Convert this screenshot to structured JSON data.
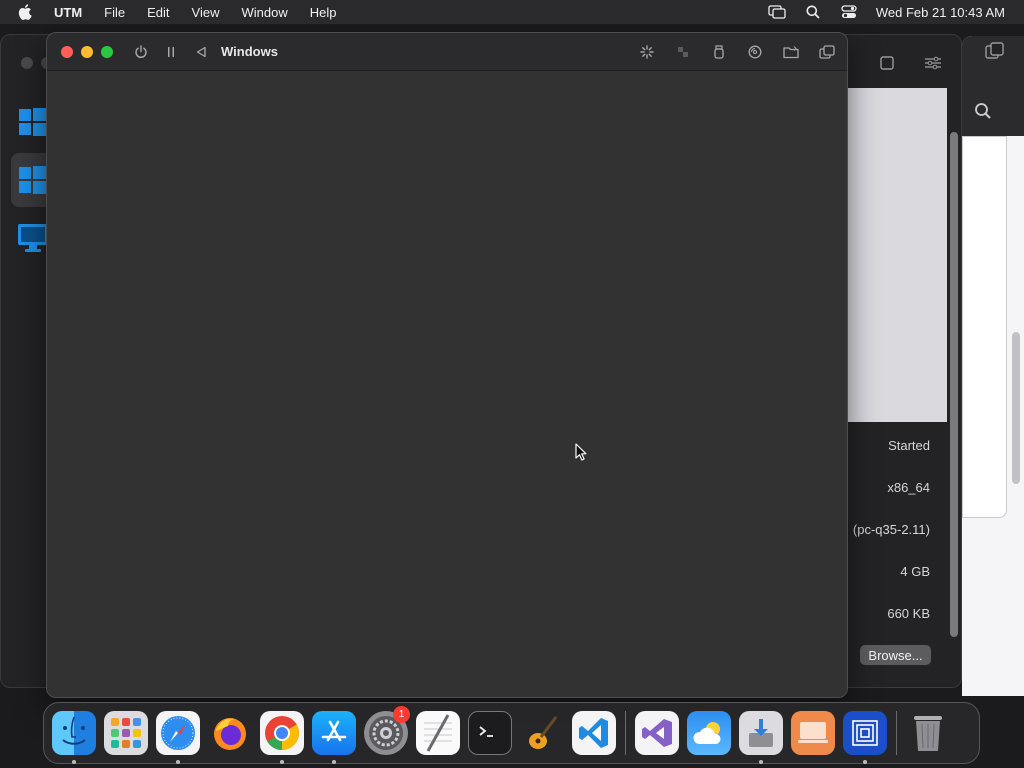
{
  "menubar": {
    "app_name": "UTM",
    "items": [
      "File",
      "Edit",
      "View",
      "Window",
      "Help"
    ],
    "clock": "Wed Feb 21  10:43 AM"
  },
  "vm_window": {
    "title": "Windows"
  },
  "library": {
    "details": [
      {
        "value": "Started"
      },
      {
        "value": "x86_64"
      },
      {
        "value": "(pc-q35-2.11)"
      },
      {
        "value": "4 GB"
      },
      {
        "value": "660 KB"
      }
    ],
    "browse_label": "Browse..."
  },
  "dock": {
    "apps": [
      {
        "name": "finder-icon",
        "running": true
      },
      {
        "name": "launchpad-icon",
        "running": false
      },
      {
        "name": "safari-icon",
        "running": true
      },
      {
        "name": "firefox-icon",
        "running": false
      },
      {
        "name": "chrome-icon",
        "running": true
      },
      {
        "name": "app-store-icon",
        "running": true
      },
      {
        "name": "system-settings-icon",
        "running": false,
        "badge": "1"
      },
      {
        "name": "textedit-icon",
        "running": false
      },
      {
        "name": "terminal-icon",
        "running": false
      },
      {
        "name": "garageband-icon",
        "running": false
      },
      {
        "name": "vscode-icon",
        "running": false
      }
    ],
    "apps2": [
      {
        "name": "visual-studio-icon",
        "running": false
      },
      {
        "name": "weather-icon",
        "running": false
      },
      {
        "name": "installer-icon",
        "running": true
      },
      {
        "name": "remote-desktop-icon",
        "running": false
      },
      {
        "name": "utm-icon",
        "running": true
      }
    ],
    "trash": {
      "name": "trash-icon"
    }
  },
  "colors": {
    "close": "#ff5f57",
    "minimize": "#febc2e",
    "maximize": "#28c840",
    "windows_blue": "#1e90e8"
  }
}
